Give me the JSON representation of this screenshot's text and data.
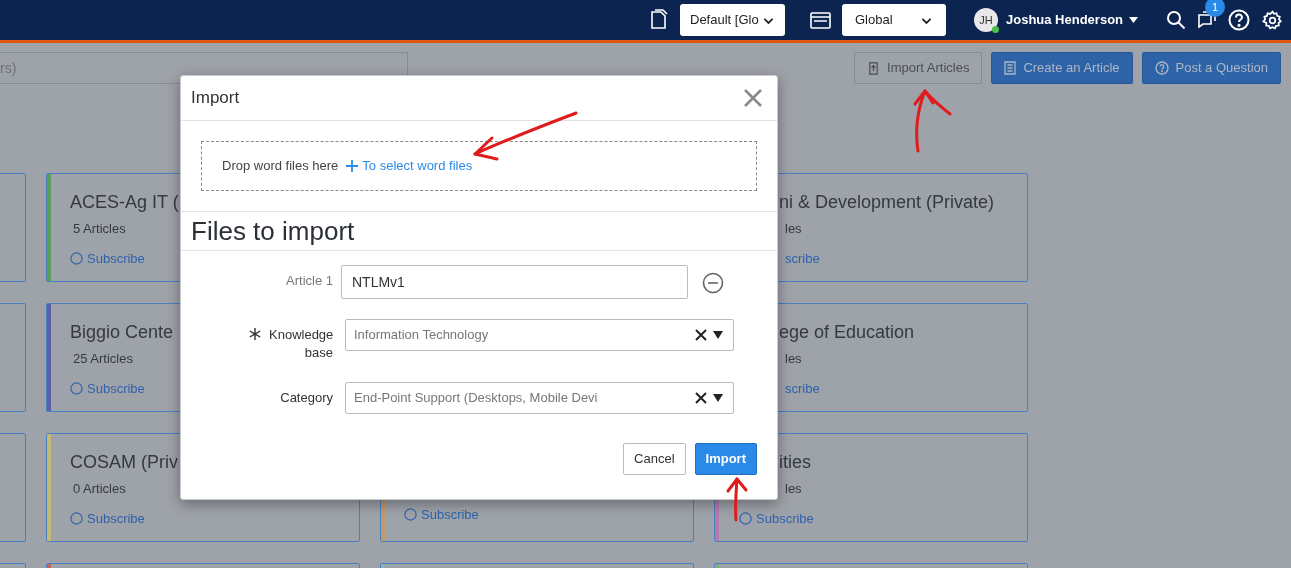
{
  "nav": {
    "selects": [
      {
        "value": "Default [Glo"
      },
      {
        "value": "Global"
      }
    ],
    "user": {
      "initials": "JH",
      "name": "Joshua Henderson",
      "online": true
    },
    "notifications_badge": "1"
  },
  "toolbar": {
    "search": {
      "placeholder": "rs)"
    },
    "buttons": [
      {
        "label": "Import Articles",
        "kind": "outline"
      },
      {
        "label": "Create an Article",
        "kind": "primary"
      },
      {
        "label": "Post a Question",
        "kind": "primary"
      }
    ]
  },
  "card_rows": [
    {
      "cards": [
        {
          "kind": "blank"
        },
        {
          "kind": "card",
          "color": "#57a05a",
          "title": "ACES-Ag IT (",
          "count": "5 Articles",
          "link": "Subscribe"
        },
        {
          "kind": "blank"
        },
        {
          "kind": "partial",
          "title": "ni & Development (Private)",
          "count": "les",
          "link": "scribe"
        }
      ]
    },
    {
      "cards": [
        {
          "kind": "blank"
        },
        {
          "kind": "card",
          "color": "#5a5fae",
          "title": "Biggio Cente",
          "count": "25 Articles",
          "link": "Subscribe"
        },
        {
          "kind": "blank"
        },
        {
          "kind": "partial",
          "title": "ege of Education",
          "count": "les",
          "link": "scribe"
        }
      ]
    },
    {
      "cards": [
        {
          "kind": "blank"
        },
        {
          "kind": "card",
          "color": "#c4b872",
          "title": "COSAM (Priv",
          "count": "0 Articles",
          "link": "Subscribe"
        },
        {
          "kind": "bottom",
          "color": "#c49a62",
          "link": "Subscribe"
        },
        {
          "kind": "edge",
          "color": "#b77aa8",
          "title": "ities",
          "count": "les",
          "link": "Subscribe"
        }
      ]
    },
    {
      "cards": [
        {
          "kind": "blank"
        },
        {
          "kind": "blank",
          "color": "#c0685a"
        },
        {
          "kind": "blank",
          "color": "#8fb3b3"
        },
        {
          "kind": "blank",
          "color": "#80ad82"
        }
      ]
    }
  ],
  "dialog": {
    "title": "Import",
    "dropzone": {
      "text": "Drop word files here",
      "link": "To select word files"
    },
    "heading": "Files to import",
    "fields": [
      {
        "kind": "text",
        "label": "Article 1",
        "value": "NTLMv1"
      },
      {
        "kind": "select",
        "label": "Knowledge base",
        "required": true,
        "value": "Information Technology"
      },
      {
        "kind": "select",
        "label": "Category",
        "value": "End-Point Support (Desktops, Mobile Devi"
      }
    ],
    "buttons": [
      {
        "label": "Cancel",
        "kind": "secondary"
      },
      {
        "label": "Import",
        "kind": "primary"
      }
    ]
  }
}
